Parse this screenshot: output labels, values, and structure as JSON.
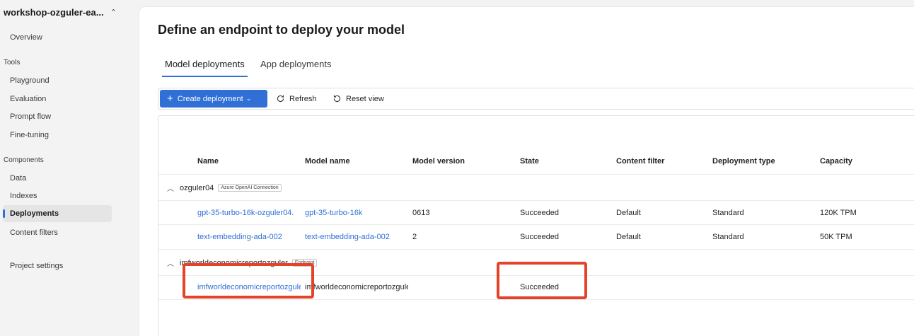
{
  "sidebar": {
    "project": "workshop-ozguler-ea...",
    "items_top": [
      "Overview"
    ],
    "tools_label": "Tools",
    "tools": [
      "Playground",
      "Evaluation",
      "Prompt flow",
      "Fine-tuning"
    ],
    "components_label": "Components",
    "components": [
      "Data",
      "Indexes",
      "Deployments",
      "Content filters"
    ],
    "active": "Deployments",
    "settings": "Project settings"
  },
  "main": {
    "title": "Define an endpoint to deploy your model",
    "tabs": [
      "Model deployments",
      "App deployments"
    ],
    "active_tab": "Model deployments"
  },
  "toolbar": {
    "create_label": "Create deployment",
    "refresh_label": "Refresh",
    "reset_label": "Reset view"
  },
  "table": {
    "columns": [
      "Name",
      "Model name",
      "Model version",
      "State",
      "Content filter",
      "Deployment type",
      "Capacity"
    ],
    "groups": [
      {
        "name": "ozguler04",
        "badge": "Azure OpenAI Connection",
        "rows": [
          [
            "gpt-35-turbo-16k-ozguler04.",
            "gpt-35-turbo-16k",
            "0613",
            "Succeeded",
            "Default",
            "Standard",
            "120K TPM"
          ],
          [
            "text-embedding-ada-002",
            "text-embedding-ada-002",
            "2",
            "Succeeded",
            "Default",
            "Standard",
            "50K TPM"
          ]
        ]
      },
      {
        "name": "imfworldeconomicreportozguler",
        "badge": "Endpoint",
        "rows": [
          [
            "imfworldeconomicreportozguler",
            "imfworldeconomicreportozguler",
            "",
            "Succeeded",
            "",
            "",
            ""
          ]
        ]
      }
    ]
  },
  "colors": {
    "accent": "#2f6fd6",
    "highlight": "#e4432a"
  }
}
